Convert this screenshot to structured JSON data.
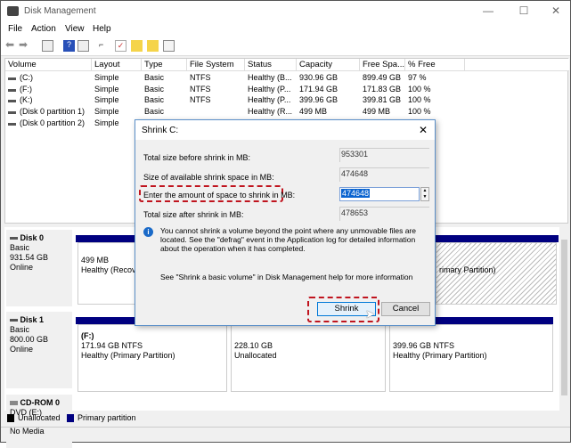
{
  "window": {
    "title": "Disk Management",
    "minimize": "—",
    "maximize": "☐",
    "close": "✕"
  },
  "menu": [
    "File",
    "Action",
    "View",
    "Help"
  ],
  "toolbar_icons": [
    "back-icon",
    "forward-icon",
    "console-tree-icon",
    "help-icon",
    "action-pane-icon",
    "connect-icon",
    "check-icon",
    "folder-up-icon",
    "folder-search-icon",
    "properties-icon"
  ],
  "list": {
    "columns": [
      "Volume",
      "Layout",
      "Type",
      "File System",
      "Status",
      "Capacity",
      "Free Spa...",
      "% Free"
    ],
    "rows": [
      [
        "(C:)",
        "Simple",
        "Basic",
        "NTFS",
        "Healthy (B...",
        "930.96 GB",
        "899.49 GB",
        "97 %"
      ],
      [
        "(F:)",
        "Simple",
        "Basic",
        "NTFS",
        "Healthy (P...",
        "171.94 GB",
        "171.83 GB",
        "100 %"
      ],
      [
        "(K:)",
        "Simple",
        "Basic",
        "NTFS",
        "Healthy (P...",
        "399.96 GB",
        "399.81 GB",
        "100 %"
      ],
      [
        "(Disk 0 partition 1)",
        "Simple",
        "Basic",
        "",
        "Healthy (R...",
        "499 MB",
        "499 MB",
        "100 %"
      ],
      [
        "(Disk 0 partition 2)",
        "Simple",
        "",
        "",
        "",
        "",
        "",
        ""
      ]
    ]
  },
  "disks": {
    "disk0": {
      "name": "Disk 0",
      "type": "Basic",
      "size": "931.54 GB",
      "state": "Online",
      "p1_size": "499 MB",
      "p1_status": "Healthy (Recove",
      "p3_status": "rimary Partition)"
    },
    "disk1": {
      "name": "Disk 1",
      "type": "Basic",
      "size": "800.00 GB",
      "state": "Online",
      "parts": [
        {
          "name": "(F:)",
          "size": "171.94 GB NTFS",
          "status": "Healthy (Primary Partition)"
        },
        {
          "name": "",
          "size": "228.10 GB",
          "status": "Unallocated"
        },
        {
          "name": "",
          "size": "399.96 GB NTFS",
          "status": "Healthy (Primary Partition)"
        }
      ]
    },
    "cdrom": {
      "name": "CD-ROM 0",
      "type": "DVD (E:)",
      "state": "No Media"
    }
  },
  "legend": {
    "unallocated": "Unallocated",
    "primary": "Primary partition",
    "colors": {
      "unallocated": "#000000",
      "primary": "#000080"
    }
  },
  "dialog": {
    "title": "Shrink C:",
    "close": "✕",
    "total_before_label": "Total size before shrink in MB:",
    "total_before": "953301",
    "available_label": "Size of available shrink space in MB:",
    "available": "474648",
    "amount_label": "Enter the amount of space to shrink in MB:",
    "amount": "474648",
    "total_after_label": "Total size after shrink in MB:",
    "total_after": "478653",
    "info": "You cannot shrink a volume beyond the point where any unmovable files are located. See the \"defrag\" event in the Application log for detailed information about the operation when it has completed.",
    "help": "See \"Shrink a basic volume\" in Disk Management help for more information",
    "shrink": "Shrink",
    "cancel": "Cancel"
  },
  "highlight_color": "#c0141e"
}
